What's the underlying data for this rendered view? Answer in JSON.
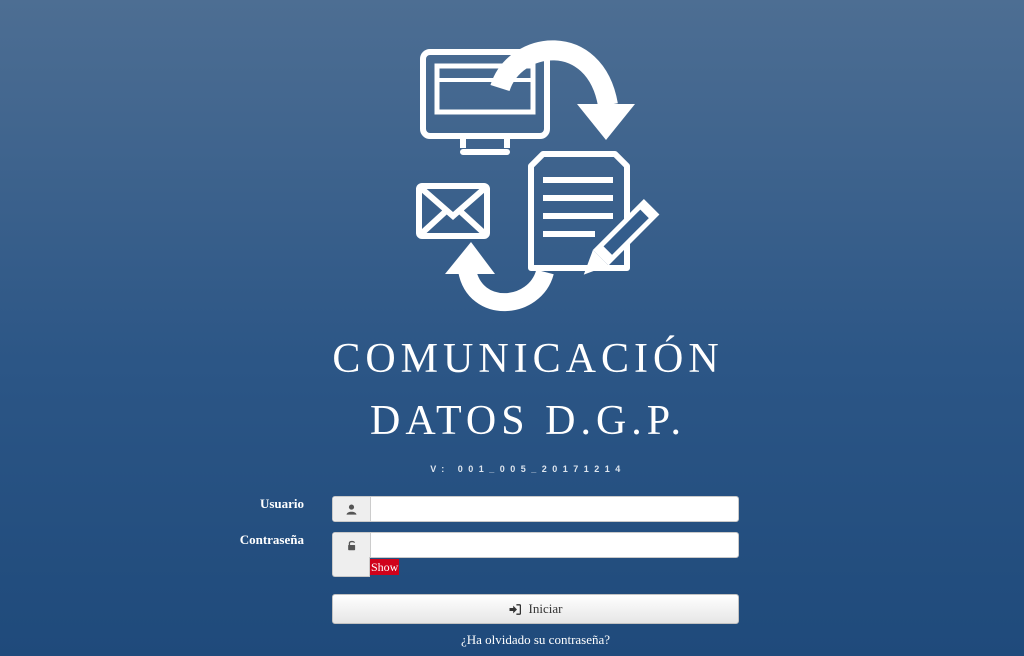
{
  "app": {
    "title_line_1": "COMUNICACIÓN",
    "title_line_2": "DATOS D.G.P.",
    "version": "V: 001_005_20171214"
  },
  "icons": {
    "logo": "computer-document-mail-exchange-icon",
    "user": "user-icon",
    "password": "unlock-icon",
    "login": "sign-in-icon"
  },
  "form": {
    "username": {
      "label": "Usuario",
      "value": "",
      "placeholder": ""
    },
    "password": {
      "label": "Contraseña",
      "value": "",
      "placeholder": ""
    },
    "show_label": "Show",
    "submit_label": "Iniciar",
    "forgot_label": "¿Ha olvidado su contraseña?"
  },
  "colors": {
    "background_top": "#4d6e93",
    "background_bottom": "#1f4a7b",
    "show_toggle": "#d0021b",
    "text": "#ffffff"
  }
}
